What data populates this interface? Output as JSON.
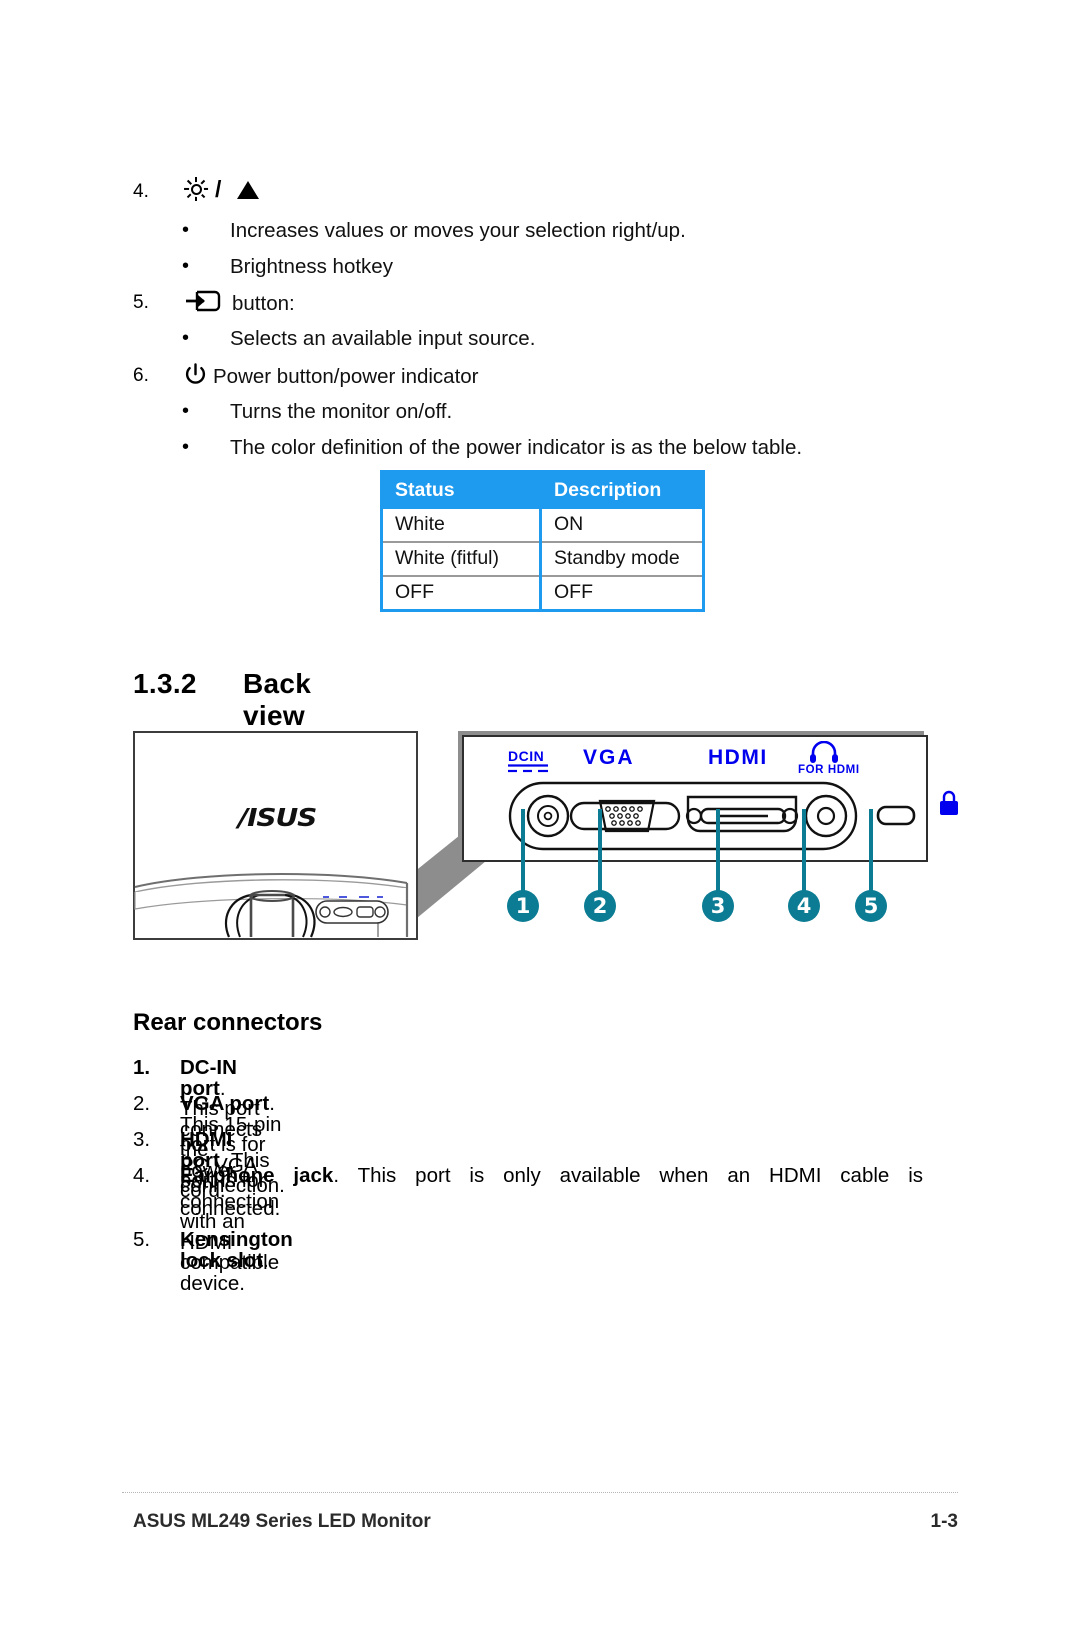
{
  "steps": [
    {
      "number": "4.",
      "icon": "brightness-up-icon",
      "heading": "",
      "bullets": [
        "Increases values or moves your selection right/up.",
        "Brightness hotkey"
      ]
    },
    {
      "number": "5.",
      "icon": "input-source-icon",
      "heading": "button:",
      "bullets": [
        "Selects an available input source."
      ]
    },
    {
      "number": "6.",
      "icon": "power-icon",
      "heading": "Power button/power indicator",
      "bullets": [
        "Turns the monitor on/off.",
        "The color definition of the power indicator is as the below table."
      ]
    }
  ],
  "status_table": {
    "headers": [
      "Status",
      "Description"
    ],
    "rows": [
      [
        "White",
        "ON"
      ],
      [
        "White (fitful)",
        "Standby mode"
      ],
      [
        "OFF",
        "OFF"
      ]
    ],
    "header_bg": "#1e9aef",
    "border_color": "#1e9aef"
  },
  "section": {
    "number": "1.3.2",
    "title": "Back view"
  },
  "figure": {
    "monitor_logo": "/ISUS",
    "panel_labels": [
      {
        "name": "dcin-label",
        "text": "DCIN"
      },
      {
        "name": "vga-label",
        "text": "VGA"
      },
      {
        "name": "hdmi-label",
        "text": "HDMI"
      },
      {
        "name": "for-hdmi-label",
        "text": "FOR HDMI"
      }
    ],
    "callouts": [
      "1",
      "2",
      "3",
      "4",
      "5"
    ],
    "callout_color": "#0b7c93",
    "label_color": "#0000ee"
  },
  "rear_connectors": {
    "heading": "Rear connectors",
    "items": [
      {
        "number": "1.",
        "term": "DC-IN port",
        "rest": ". This port connects the power cord."
      },
      {
        "number": "2.",
        "term": "VGA port",
        "rest": ". This 15-pin port is for PC VGA connection."
      },
      {
        "number": "3.",
        "term": "HDMI port",
        "rest": ". This port is for connection with an HDMI compatible device."
      },
      {
        "number": "4.",
        "term": "Earphone jack",
        "rest": ". This port is only available when an HDMI cable is",
        "continuation": "connected."
      },
      {
        "number": "5.",
        "term": "Kensington lock slot",
        "rest": "."
      }
    ]
  },
  "footer": {
    "left": "ASUS ML249 Series LED Monitor",
    "right": "1-3"
  }
}
